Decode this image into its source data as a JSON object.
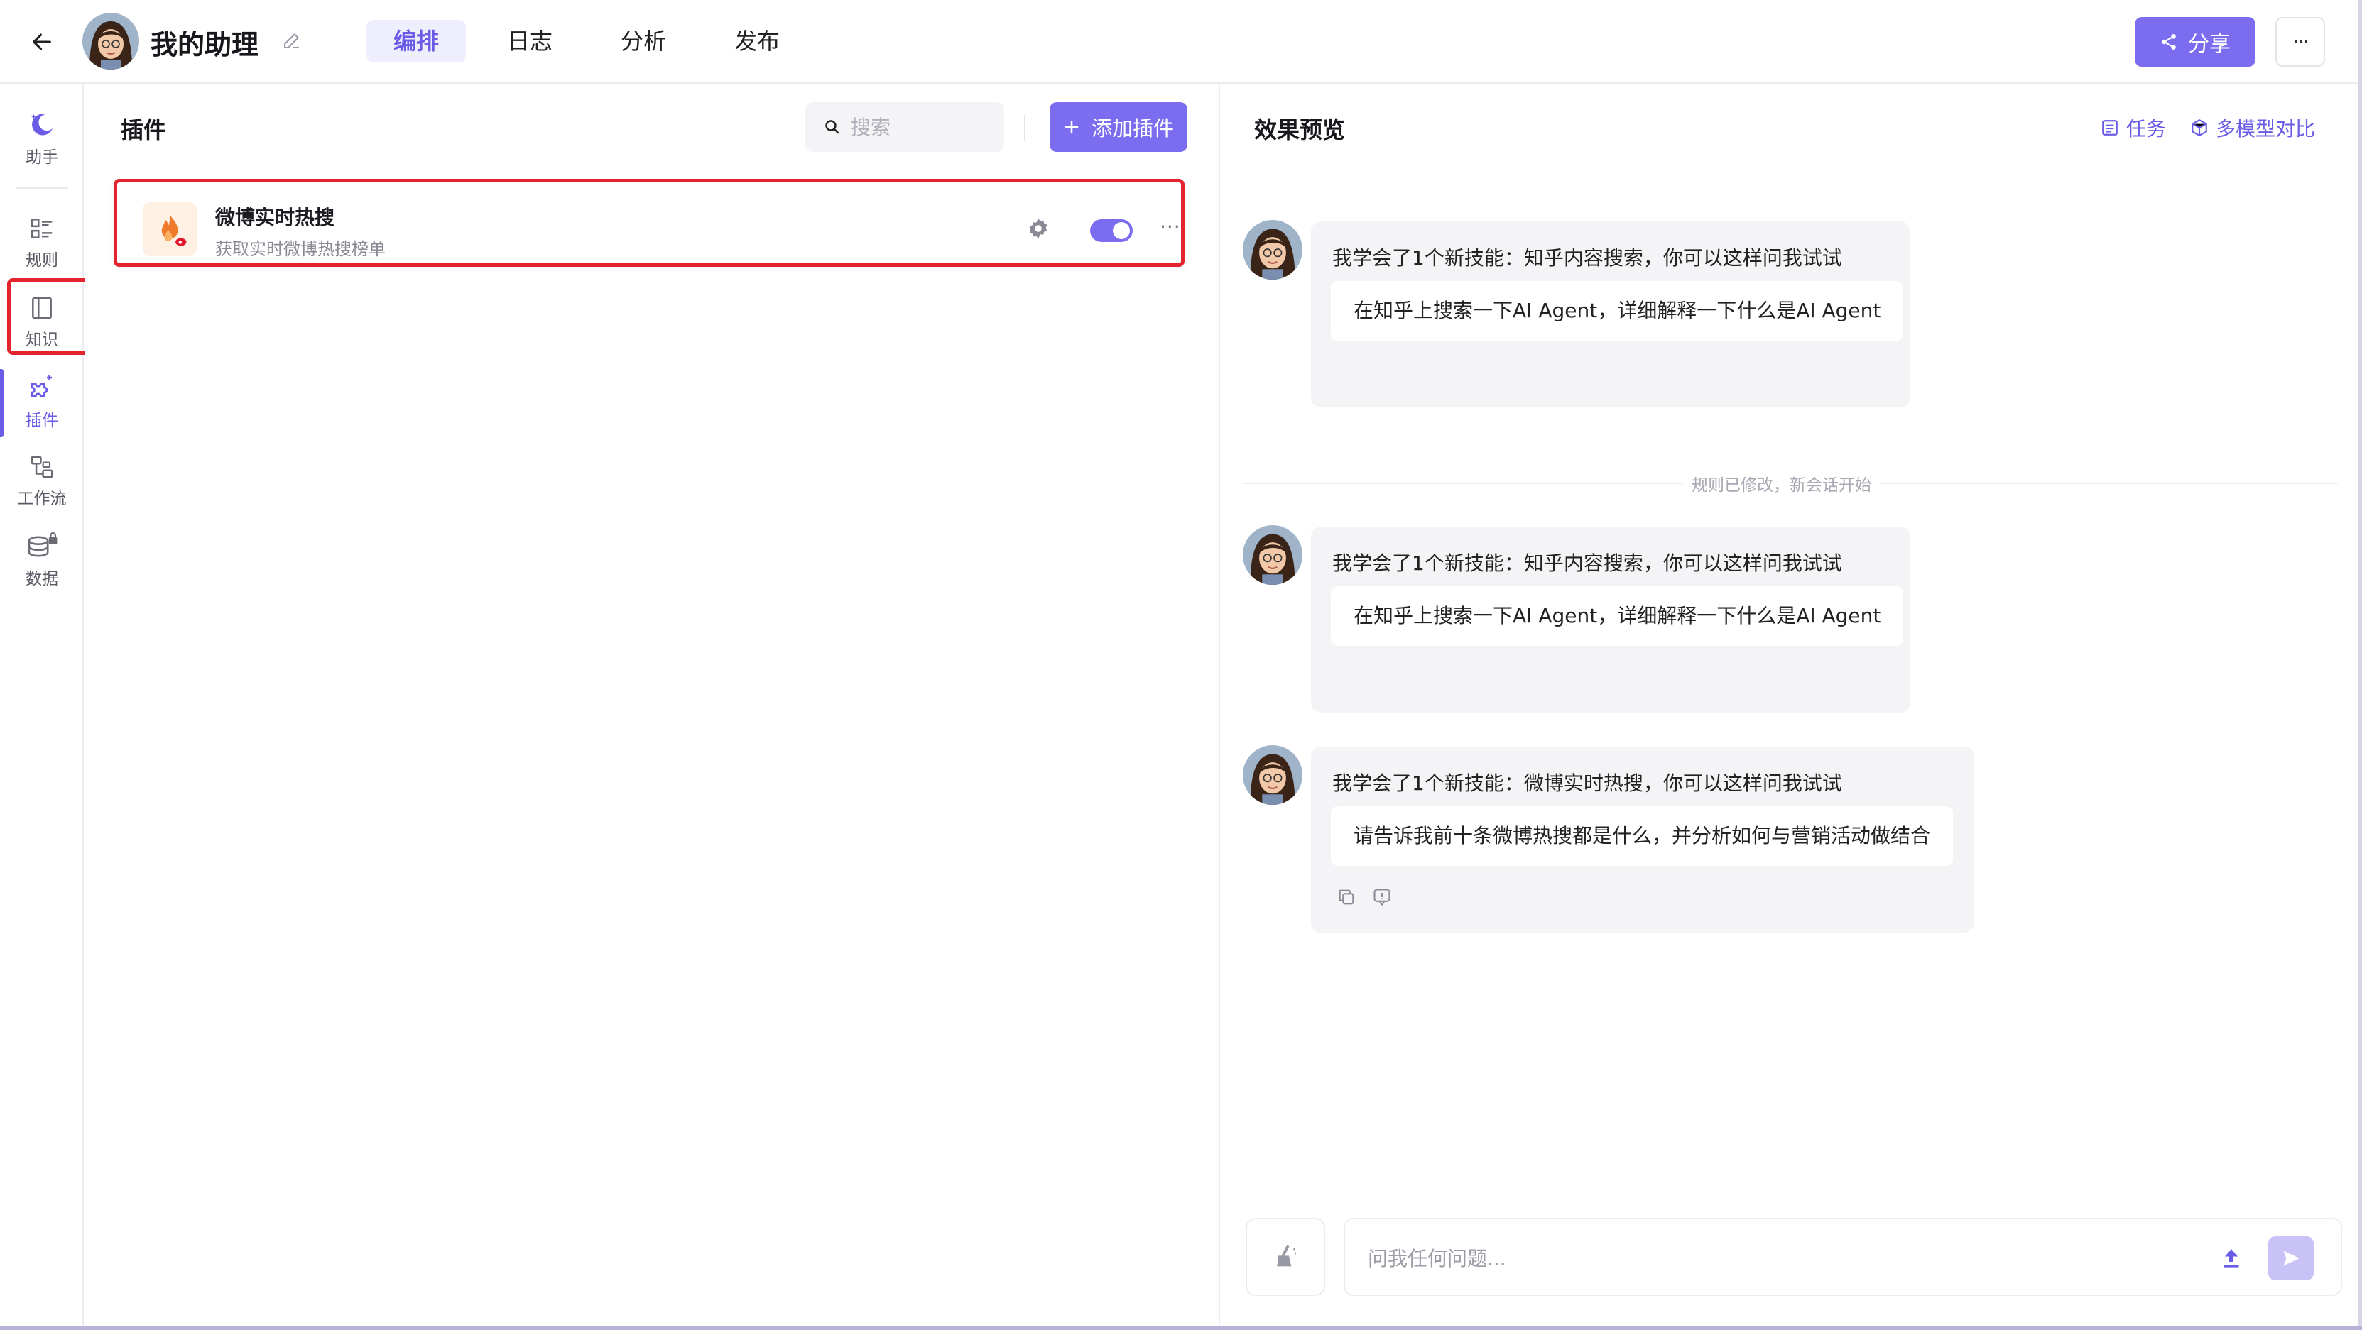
{
  "header": {
    "app_name": "我的助理",
    "tabs": [
      {
        "label": "编排",
        "active": true
      },
      {
        "label": "日志",
        "active": false
      },
      {
        "label": "分析",
        "active": false
      },
      {
        "label": "发布",
        "active": false
      }
    ],
    "share_label": "分享",
    "more_label": "···"
  },
  "sidebar": {
    "items": [
      {
        "label": "助手",
        "icon": "assistant-icon"
      },
      {
        "label": "规则",
        "icon": "rules-icon"
      },
      {
        "label": "知识",
        "icon": "knowledge-icon"
      },
      {
        "label": "插件",
        "icon": "plugin-icon",
        "active": true
      },
      {
        "label": "工作流",
        "icon": "workflow-icon"
      },
      {
        "label": "数据",
        "icon": "database-icon",
        "locked": true
      }
    ]
  },
  "plugins": {
    "title": "插件",
    "search_placeholder": "搜索",
    "add_label": "添加插件",
    "items": [
      {
        "name": "微博实时热搜",
        "description": "获取实时微博热搜榜单",
        "enabled": true
      }
    ]
  },
  "preview": {
    "title": "效果预览",
    "actions": {
      "tasks": "任务",
      "compare": "多模型对比"
    },
    "divider": "规则已修改，新会话开始",
    "messages": [
      {
        "intro": "我学会了1个新技能：知乎内容搜索，你可以这样问我试试",
        "suggestion": "在知乎上搜索一下AI Agent，详细解释一下什么是AI Agent"
      },
      {
        "intro": "我学会了1个新技能：知乎内容搜索，你可以这样问我试试",
        "suggestion": "在知乎上搜索一下AI Agent，详细解释一下什么是AI Agent"
      },
      {
        "intro": "我学会了1个新技能：微博实时热搜，你可以这样问我试试",
        "suggestion": "请告诉我前十条微博热搜都是什么，并分析如何与营销活动做结合"
      }
    ],
    "input_placeholder": "问我任何问题..."
  },
  "colors": {
    "accent": "#7b6cf0",
    "highlight_border": "#e3232e"
  }
}
